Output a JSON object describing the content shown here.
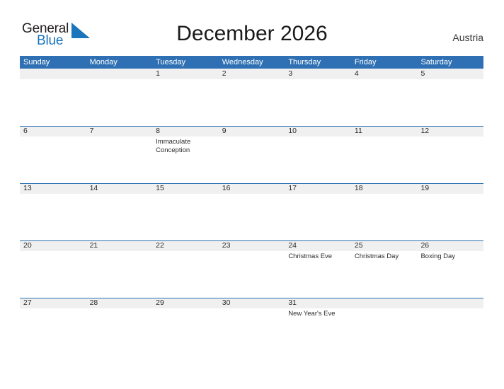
{
  "logo": {
    "text_top": "General",
    "text_bottom": "Blue",
    "triangle_color": "#1b75bb"
  },
  "header": {
    "title": "December 2026",
    "country": "Austria"
  },
  "colors": {
    "header_blue": "#2e70b3",
    "band_gray": "#f0f0f0",
    "logo_blue": "#1b75bb",
    "text_dark": "#2b2b2b"
  },
  "weekdays": [
    "Sunday",
    "Monday",
    "Tuesday",
    "Wednesday",
    "Thursday",
    "Friday",
    "Saturday"
  ],
  "weeks": [
    [
      {
        "date": "",
        "event": ""
      },
      {
        "date": "",
        "event": ""
      },
      {
        "date": "1",
        "event": ""
      },
      {
        "date": "2",
        "event": ""
      },
      {
        "date": "3",
        "event": ""
      },
      {
        "date": "4",
        "event": ""
      },
      {
        "date": "5",
        "event": ""
      }
    ],
    [
      {
        "date": "6",
        "event": ""
      },
      {
        "date": "7",
        "event": ""
      },
      {
        "date": "8",
        "event": "Immaculate Conception"
      },
      {
        "date": "9",
        "event": ""
      },
      {
        "date": "10",
        "event": ""
      },
      {
        "date": "11",
        "event": ""
      },
      {
        "date": "12",
        "event": ""
      }
    ],
    [
      {
        "date": "13",
        "event": ""
      },
      {
        "date": "14",
        "event": ""
      },
      {
        "date": "15",
        "event": ""
      },
      {
        "date": "16",
        "event": ""
      },
      {
        "date": "17",
        "event": ""
      },
      {
        "date": "18",
        "event": ""
      },
      {
        "date": "19",
        "event": ""
      }
    ],
    [
      {
        "date": "20",
        "event": ""
      },
      {
        "date": "21",
        "event": ""
      },
      {
        "date": "22",
        "event": ""
      },
      {
        "date": "23",
        "event": ""
      },
      {
        "date": "24",
        "event": "Christmas Eve"
      },
      {
        "date": "25",
        "event": "Christmas Day"
      },
      {
        "date": "26",
        "event": "Boxing Day"
      }
    ],
    [
      {
        "date": "27",
        "event": ""
      },
      {
        "date": "28",
        "event": ""
      },
      {
        "date": "29",
        "event": ""
      },
      {
        "date": "30",
        "event": ""
      },
      {
        "date": "31",
        "event": "New Year's Eve"
      },
      {
        "date": "",
        "event": ""
      },
      {
        "date": "",
        "event": ""
      }
    ]
  ]
}
